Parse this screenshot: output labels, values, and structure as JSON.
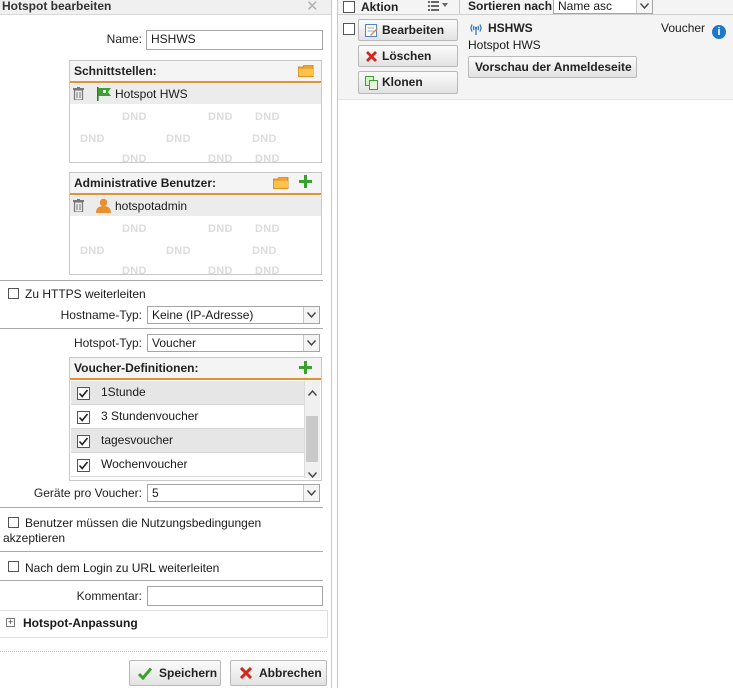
{
  "editor": {
    "title": "Hotspot bearbeiten",
    "name_label": "Name:",
    "name_value": "HSHWS",
    "interfaces": {
      "header": "Schnittstellen:",
      "items": [
        "Hotspot HWS"
      ],
      "dnd": "DND"
    },
    "admins": {
      "header": "Administrative Benutzer:",
      "items": [
        "hotspotadmin"
      ],
      "dnd": "DND"
    },
    "https_redirect": {
      "label": "Zu HTTPS weiterleiten",
      "checked": false
    },
    "hostname_type": {
      "label": "Hostname-Typ:",
      "value": "Keine (IP-Adresse)"
    },
    "hotspot_type": {
      "label": "Hotspot-Typ:",
      "value": "Voucher"
    },
    "voucher_defs": {
      "header": "Voucher-Definitionen:",
      "items": [
        {
          "label": "1Stunde",
          "checked": true
        },
        {
          "label": "3 Stundenvoucher",
          "checked": true
        },
        {
          "label": "tagesvoucher",
          "checked": true
        },
        {
          "label": "Wochenvoucher",
          "checked": true
        }
      ]
    },
    "devices_per_voucher": {
      "label": "Geräte pro Voucher:",
      "value": "5"
    },
    "terms": {
      "line1": "Benutzer müssen die Nutzungsbedingungen",
      "line2": "akzeptieren",
      "checked": false
    },
    "redirect_url": {
      "label": "Nach dem Login zu URL weiterleiten",
      "checked": false
    },
    "comment": {
      "label": "Kommentar:",
      "value": ""
    },
    "customization": {
      "label": "Hotspot-Anpassung",
      "expand_glyph": "+"
    },
    "save_label": "Speichern",
    "cancel_label": "Abbrechen"
  },
  "list": {
    "header": {
      "action_label": "Aktion",
      "sort_label": "Sortieren nach:",
      "sort_value": "Name asc"
    },
    "entry": {
      "name": "HSHWS",
      "interface": "Hotspot HWS",
      "type": "Voucher",
      "edit_label": "Bearbeiten",
      "delete_label": "Löschen",
      "clone_label": "Klonen",
      "preview_label": "Vorschau der Anmeldeseite"
    }
  },
  "colors": {
    "accent": "#e8902e",
    "add_green": "#3aa12e",
    "delete_red": "#d0281c",
    "info_blue": "#1f78c8"
  }
}
